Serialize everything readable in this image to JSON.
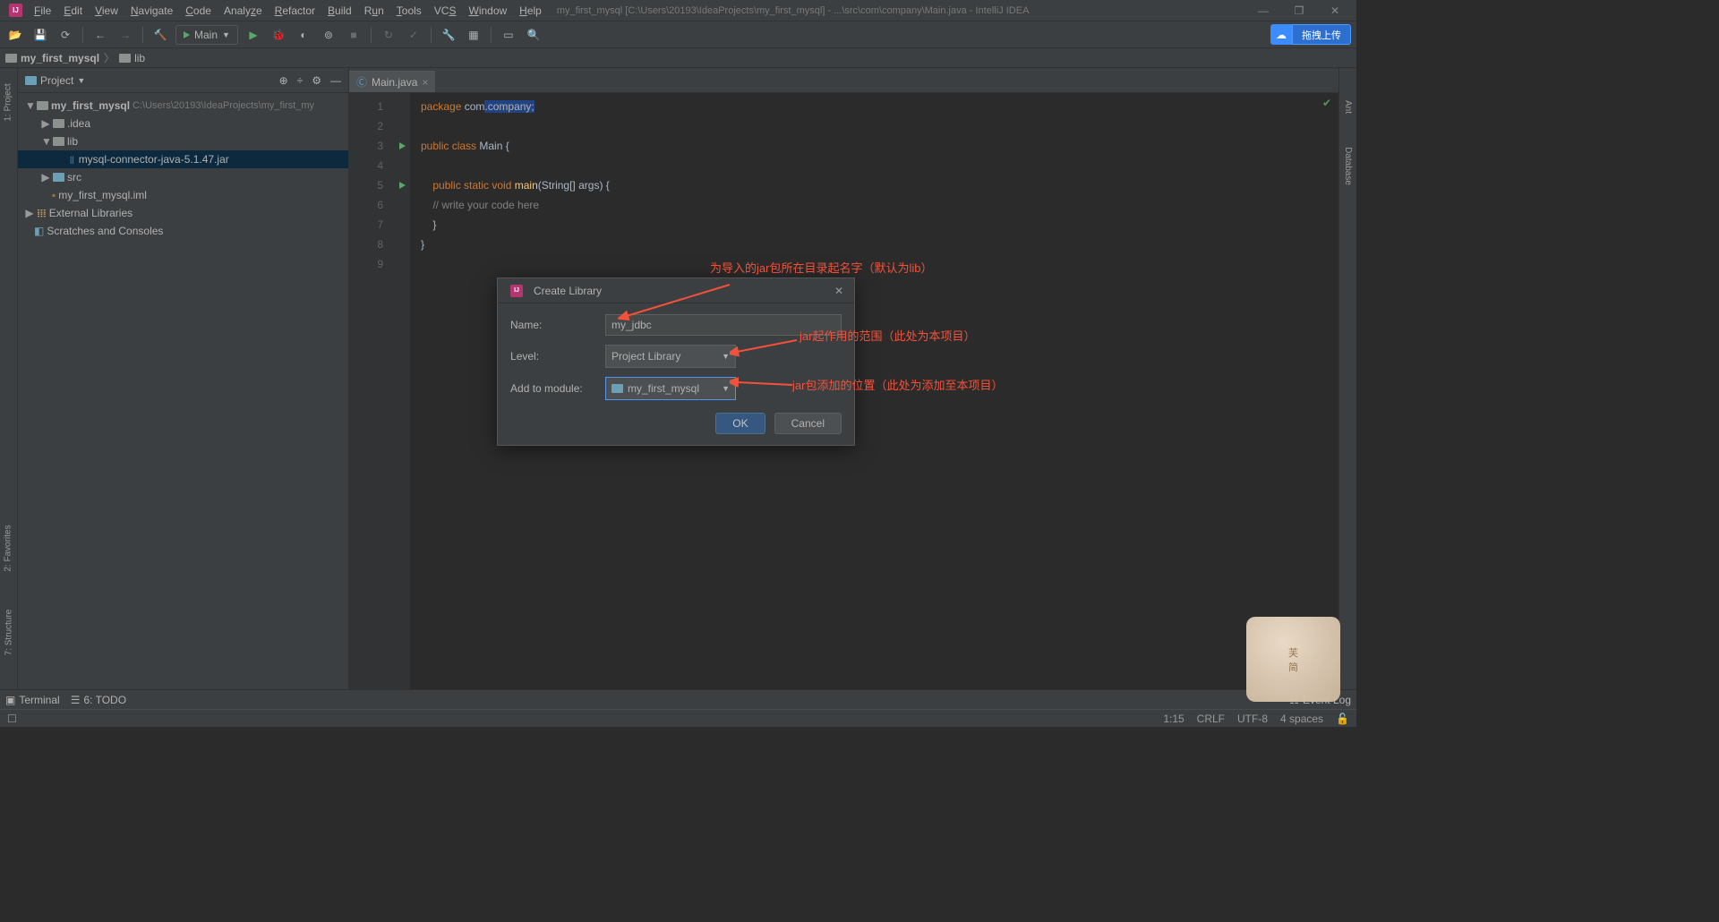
{
  "menubar": {
    "items": [
      "File",
      "Edit",
      "View",
      "Navigate",
      "Code",
      "Analyze",
      "Refactor",
      "Build",
      "Run",
      "Tools",
      "VCS",
      "Window",
      "Help"
    ],
    "title_path": "my_first_mysql [C:\\Users\\20193\\IdeaProjects\\my_first_mysql] - ...\\src\\com\\company\\Main.java - IntelliJ IDEA"
  },
  "toolbar": {
    "run_config": "Main",
    "upload_btn": "拖拽上传"
  },
  "breadcrumbs": {
    "project": "my_first_mysql",
    "folder": "lib"
  },
  "project_panel": {
    "title": "Project",
    "root": {
      "name": "my_first_mysql",
      "path": "C:\\Users\\20193\\IdeaProjects\\my_first_my"
    },
    "idea": ".idea",
    "lib": "lib",
    "jar": "mysql-connector-java-5.1.47.jar",
    "src": "src",
    "iml": "my_first_mysql.iml",
    "ext_lib": "External Libraries",
    "scratches": "Scratches and Consoles"
  },
  "tool_windows": {
    "left_top": "1: Project",
    "left_mid": "2: Favorites",
    "left_bot": "7: Structure",
    "right_top": "Ant",
    "right_mid": "Database"
  },
  "editor": {
    "tab": "Main.java",
    "lines": {
      "l1a": "package",
      "l1b": "com",
      "l1c": ".company;",
      "l3a": "public class ",
      "l3b": "Main",
      "l3c": " {",
      "l5a": "public static void ",
      "l5b": "main",
      "l5c": "(String[] args) {",
      "l6": "// write your code here",
      "l7": "}",
      "l8": "}"
    }
  },
  "dialog": {
    "title": "Create Library",
    "name_lbl": "Name:",
    "name_val": "my_jdbc",
    "level_lbl": "Level:",
    "level_val": "Project Library",
    "module_lbl": "Add to module:",
    "module_val": "my_first_mysql",
    "ok": "OK",
    "cancel": "Cancel"
  },
  "annotations": {
    "a1": "为导入的jar包所在目录起名字（默认为lib）",
    "a2": "jar起作用的范围（此处为本项目）",
    "a3": "jar包添加的位置（此处为添加至本项目）"
  },
  "bottom_tabs": {
    "terminal": "Terminal",
    "todo": "6: TODO",
    "event_log": "Event Log"
  },
  "status": {
    "pos": "1:15",
    "eol": "CRLF",
    "enc": "UTF-8",
    "indent": "4 spaces"
  }
}
